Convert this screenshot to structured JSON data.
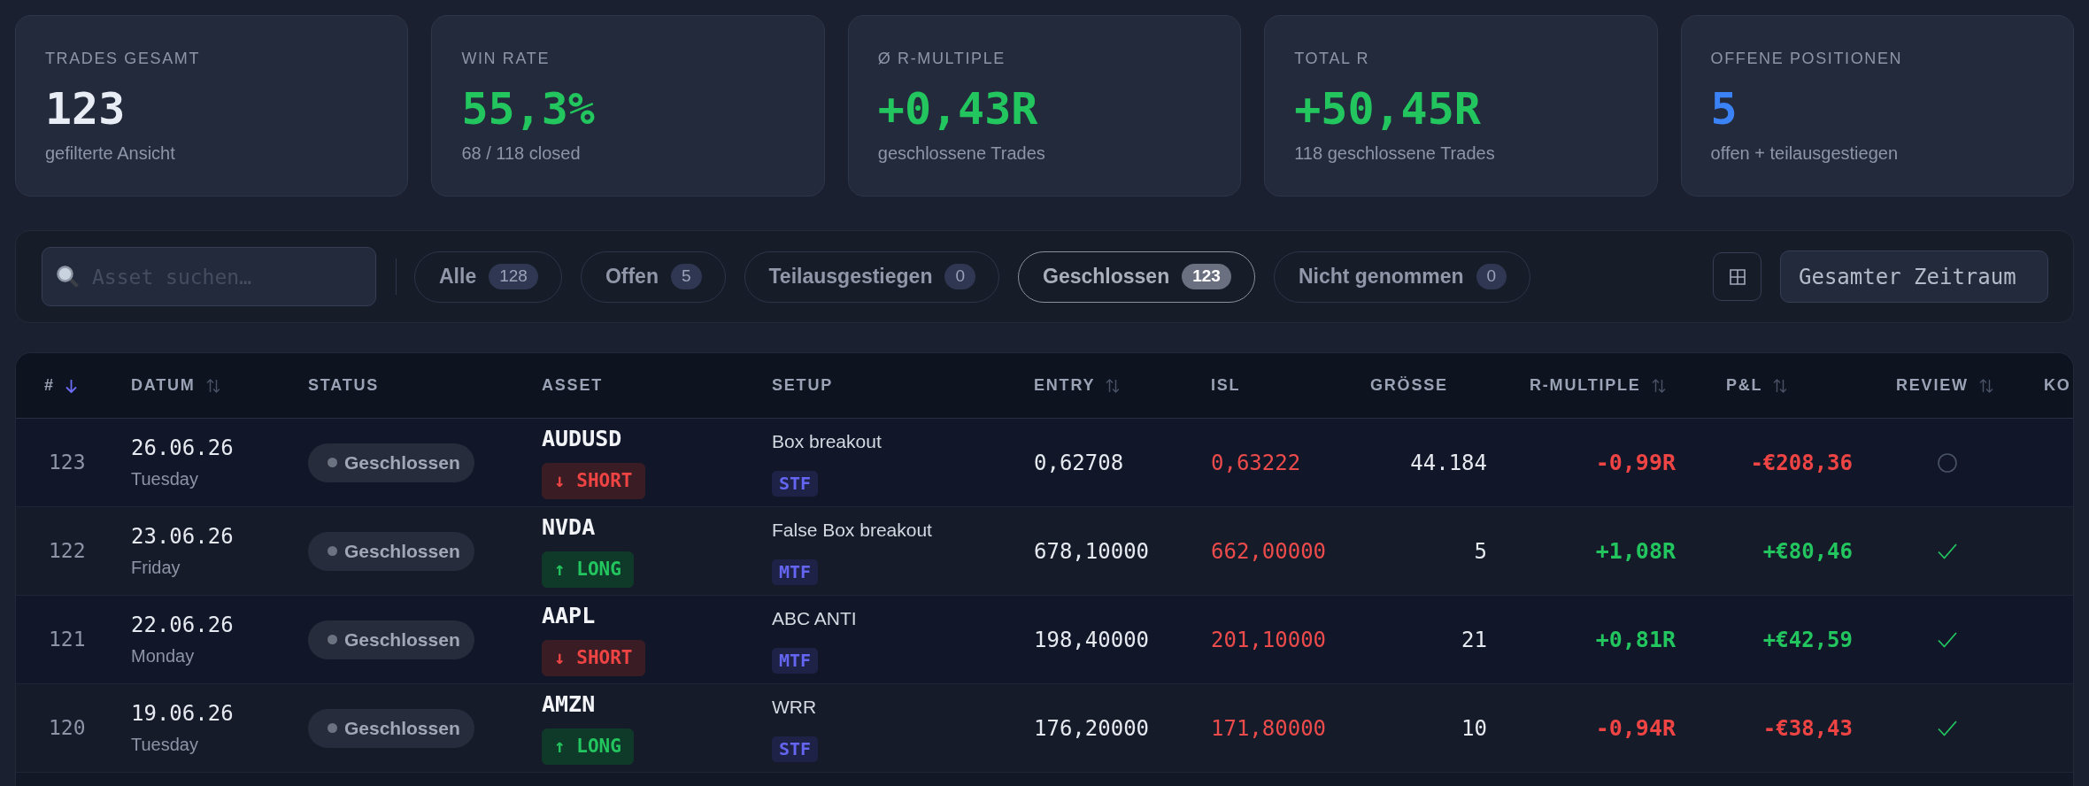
{
  "stats": [
    {
      "label": "TRADES GESAMT",
      "value": "123",
      "caption": "gefilterte Ansicht",
      "color": "#e8ecf4"
    },
    {
      "label": "WIN RATE",
      "value": "55,3%",
      "caption": "68 / 118 closed",
      "color": "#22c55e"
    },
    {
      "label": "Ø R-MULTIPLE",
      "value": "+0,43R",
      "caption": "geschlossene Trades",
      "color": "#22c55e"
    },
    {
      "label": "TOTAL R",
      "value": "+50,45R",
      "caption": "118 geschlossene Trades",
      "color": "#22c55e"
    },
    {
      "label": "OFFENE POSITIONEN",
      "value": "5",
      "caption": "offen + teilausgestiegen",
      "color": "#3b82f6"
    }
  ],
  "filters": {
    "search": {
      "placeholder": "Asset suchen…"
    },
    "tabs": [
      {
        "label": "Alle",
        "count": "128",
        "selected": false
      },
      {
        "label": "Offen",
        "count": "5",
        "selected": false
      },
      {
        "label": "Teilausgestiegen",
        "count": "0",
        "selected": false
      },
      {
        "label": "Geschlossen",
        "count": "123",
        "selected": true
      },
      {
        "label": "Nicht genommen",
        "count": "0",
        "selected": false
      }
    ],
    "period": "Gesamter Zeitraum"
  },
  "table": {
    "columns": [
      {
        "label": "#",
        "sortable": true,
        "sorted": true
      },
      {
        "label": "DATUM",
        "sortable": true,
        "sorted": false
      },
      {
        "label": "STATUS",
        "sortable": false,
        "sorted": false
      },
      {
        "label": "ASSET",
        "sortable": false,
        "sorted": false
      },
      {
        "label": "SETUP",
        "sortable": false,
        "sorted": false
      },
      {
        "label": "ENTRY",
        "sortable": true,
        "sorted": false
      },
      {
        "label": "ISL",
        "sortable": false,
        "sorted": false
      },
      {
        "label": "GRÖSSE",
        "sortable": false,
        "sorted": false
      },
      {
        "label": "R-MULTIPLE",
        "sortable": true,
        "sorted": false
      },
      {
        "label": "P&L",
        "sortable": true,
        "sorted": false
      },
      {
        "label": "REVIEW",
        "sortable": true,
        "sorted": false
      },
      {
        "label": "KO",
        "sortable": false,
        "sorted": false
      }
    ],
    "rows": [
      {
        "number": "123",
        "date": "26.06.26",
        "weekday": "Tuesday",
        "status": "Geschlossen",
        "asset": "AUDUSD",
        "direction": {
          "kind": "short",
          "label": "↓ SHORT"
        },
        "setup": "Box breakout",
        "timeframe": "STF",
        "entry": "0,62708",
        "isl": "0,63222",
        "size": "44.184",
        "r_multiple": "-0,99R",
        "pnl": "-€208,36",
        "profitable": false,
        "reviewed": false
      },
      {
        "number": "122",
        "date": "23.06.26",
        "weekday": "Friday",
        "status": "Geschlossen",
        "asset": "NVDA",
        "direction": {
          "kind": "long",
          "label": "↑ LONG"
        },
        "setup": "False Box breakout",
        "timeframe": "MTF",
        "entry": "678,10000",
        "isl": "662,00000",
        "size": "5",
        "r_multiple": "+1,08R",
        "pnl": "+€80,46",
        "profitable": true,
        "reviewed": true
      },
      {
        "number": "121",
        "date": "22.06.26",
        "weekday": "Monday",
        "status": "Geschlossen",
        "asset": "AAPL",
        "direction": {
          "kind": "short",
          "label": "↓ SHORT"
        },
        "setup": "ABC ANTI",
        "timeframe": "MTF",
        "entry": "198,40000",
        "isl": "201,10000",
        "size": "21",
        "r_multiple": "+0,81R",
        "pnl": "+€42,59",
        "profitable": true,
        "reviewed": true
      },
      {
        "number": "120",
        "date": "19.06.26",
        "weekday": "Tuesday",
        "status": "Geschlossen",
        "asset": "AMZN",
        "direction": {
          "kind": "long",
          "label": "↑ LONG"
        },
        "setup": "WRR",
        "timeframe": "STF",
        "entry": "176,20000",
        "isl": "171,80000",
        "size": "10",
        "r_multiple": "-0,94R",
        "pnl": "-€38,43",
        "profitable": false,
        "reviewed": true
      }
    ]
  }
}
